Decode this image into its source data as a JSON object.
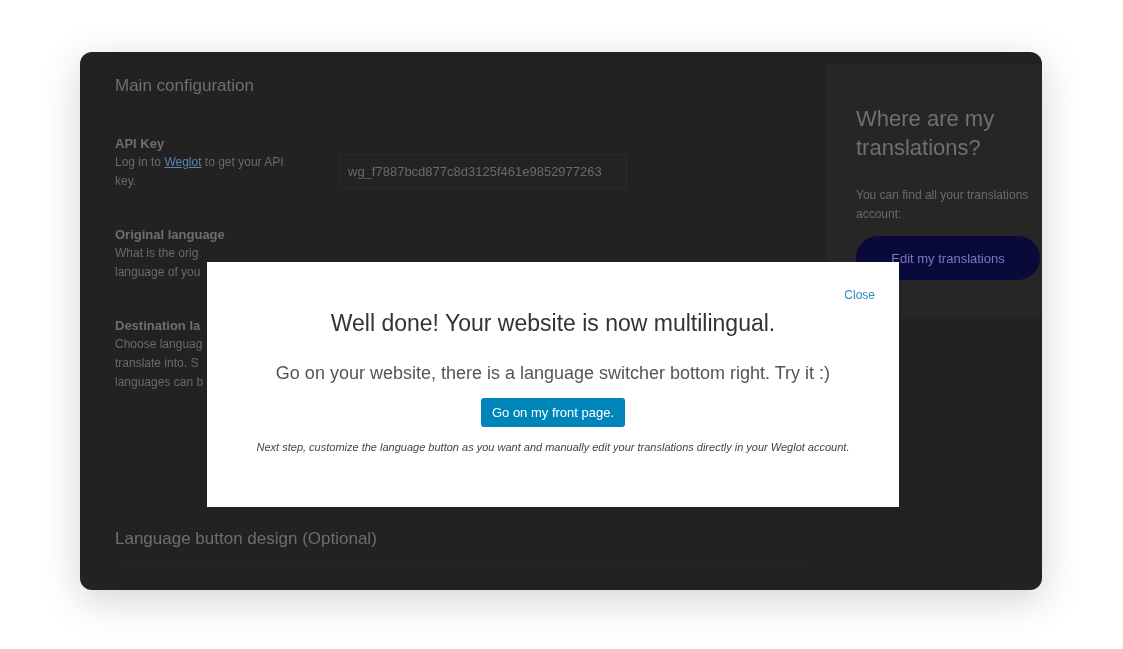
{
  "main_configuration": {
    "title": "Main configuration",
    "fields": [
      {
        "label": "API Key",
        "help_before": "Log in to ",
        "help_link": "Weglot",
        "help_after": " to get your API key.",
        "value": "wg_f7887bcd877c8d3125f461e9852977263"
      },
      {
        "label": "Original language",
        "help": "What is the orig\nlanguage of you"
      },
      {
        "label": "Destination la",
        "help": "Choose languag\ntranslate into. S\nlanguages can b"
      }
    ]
  },
  "section_title": "Language button design (Optional)",
  "sidebar": {
    "title": "Where are my translations?",
    "text": "You can find all your translations\naccount:",
    "button": "Edit my translations"
  },
  "modal": {
    "close": "Close",
    "title": "Well done! Your website is now multilingual.",
    "subtitle": "Go on your website, there is a language switcher bottom right. Try it :)",
    "button": "Go on my front page.",
    "note": "Next step, customize the language button as you want and manually edit your translations directly in your Weglot account."
  }
}
